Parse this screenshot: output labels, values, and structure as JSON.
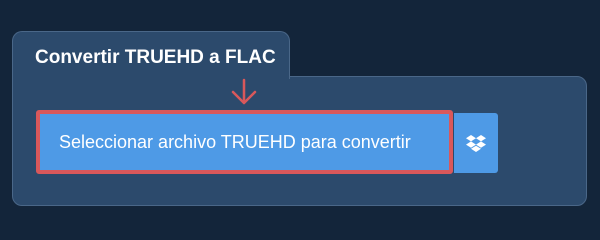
{
  "converter": {
    "title": "Convertir TRUEHD a FLAC",
    "upload_button_label": "Seleccionar archivo TRUEHD para convertir",
    "icons": {
      "pointer": "arrow-down-icon",
      "cloud": "dropbox-icon"
    }
  },
  "colors": {
    "page_background": "#13253a",
    "panel_background": "#2c4a6c",
    "button_background": "#4e9ae6",
    "highlight_border": "#d9585b"
  }
}
